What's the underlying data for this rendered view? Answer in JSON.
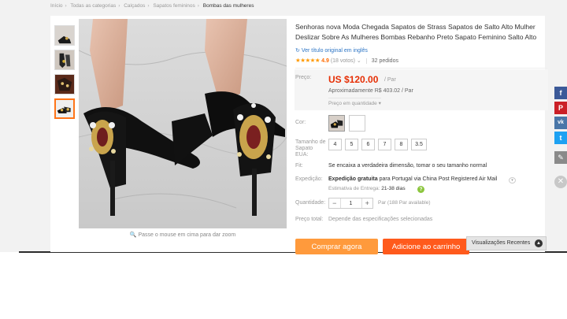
{
  "breadcrumb": [
    {
      "label": "Início"
    },
    {
      "label": "Todas as categorias"
    },
    {
      "label": "Calçados"
    },
    {
      "label": "Sapatos femininos"
    },
    {
      "label": "Bombas das mulheres"
    }
  ],
  "product": {
    "title": "Senhoras nova Moda Chegada Sapatos de Strass Sapatos de Salto Alto Mulher Deslizar Sobre As Mulheres Bombas Rebanho Preto Sapato Feminino Salto Alto",
    "original_title_link": "Ver título original em inglês",
    "rating_stars": "★★★★★",
    "rating_score": "4.9",
    "rating_votes": "(18 votos)",
    "orders": "32 pedidos"
  },
  "price": {
    "label": "Preço:",
    "value": "US $120.00",
    "unit": "/ Par",
    "approx": "Aproximadamente R$ 403.02 / Par",
    "quantity_price": "Preço em quantidade ▾"
  },
  "options": {
    "color_label": "Cor:",
    "size_label": "Tamanho de Sapato EUA:",
    "sizes": [
      "4",
      "5",
      "6",
      "7",
      "8",
      "3.5"
    ],
    "fit_label": "Fit:",
    "fit_value": "Se encaixa a verdadeira dimensão, tomar o seu tamanho normal"
  },
  "shipping": {
    "label": "Expedição:",
    "value_bold": "Expedição gratuita",
    "value_rest": "para Portugal via China Post Registered Air Mail",
    "estimate_label": "Estimativa de Entrega:",
    "estimate_value": "21-38  dias"
  },
  "quantity": {
    "label": "Quantidade:",
    "value": "1",
    "minus": "−",
    "plus": "+",
    "available": "Par (188 Par available)"
  },
  "total": {
    "label": "Preço total:",
    "value": "Depende das especificações selecionadas"
  },
  "actions": {
    "buy_now": "Comprar agora",
    "add_to_cart": "Adicione ao carrinho"
  },
  "gallery": {
    "zoom_hint": "Passe o mouse em cima para dar zoom"
  },
  "recent": {
    "label": "Visualizações Recentes"
  },
  "share": [
    {
      "icon": "facebook-icon",
      "glyph": "f",
      "color": "#3b5998"
    },
    {
      "icon": "pinterest-icon",
      "glyph": "P",
      "color": "#cb2027"
    },
    {
      "icon": "vk-icon",
      "glyph": "vk",
      "color": "#4a76a8"
    },
    {
      "icon": "twitter-icon",
      "glyph": "t",
      "color": "#1da1f2"
    },
    {
      "icon": "edit-icon",
      "glyph": "✎",
      "color": "#8a8a8a"
    }
  ],
  "colors": {
    "price": "#e62e04",
    "buy_now": "#ff9a3c",
    "add_cart": "#ff5a1c",
    "link": "#2d75c5"
  }
}
